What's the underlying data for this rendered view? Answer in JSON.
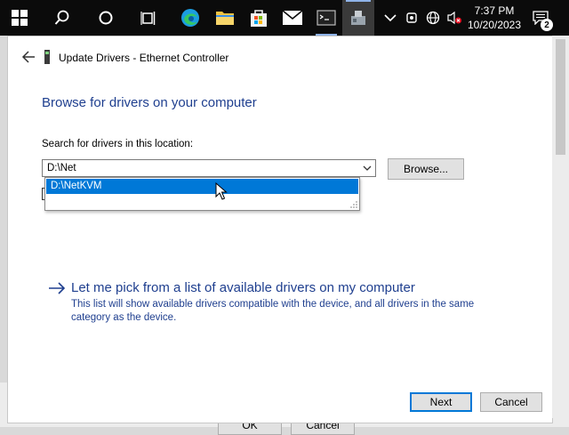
{
  "taskbar": {
    "clock_time": "7:37 PM",
    "clock_date": "10/20/2023",
    "notification_count": "2",
    "apps": [
      "windows-start",
      "search",
      "cortana",
      "task-view",
      "edge",
      "file-explorer",
      "store",
      "mail",
      "terminal",
      "device-manager"
    ]
  },
  "behind_window": {
    "ok_label": "OK",
    "cancel_label": "Cancel"
  },
  "dialog": {
    "title": "Update Drivers - Ethernet Controller",
    "heading": "Browse for drivers on your computer",
    "search_label": "Search for drivers in this location:",
    "path_value": "D:\\Net",
    "dropdown_suggestion": "D:\\NetKVM",
    "browse_label": "Browse...",
    "pick_title": "Let me pick from a list of available drivers on my computer",
    "pick_description": "This list will show available drivers compatible with the device, and all drivers in the same category as the device.",
    "next_label": "Next",
    "cancel_label": "Cancel"
  },
  "colors": {
    "accent": "#0078d7",
    "link": "#1f3f8f",
    "taskbar": "#0b0b0b"
  }
}
